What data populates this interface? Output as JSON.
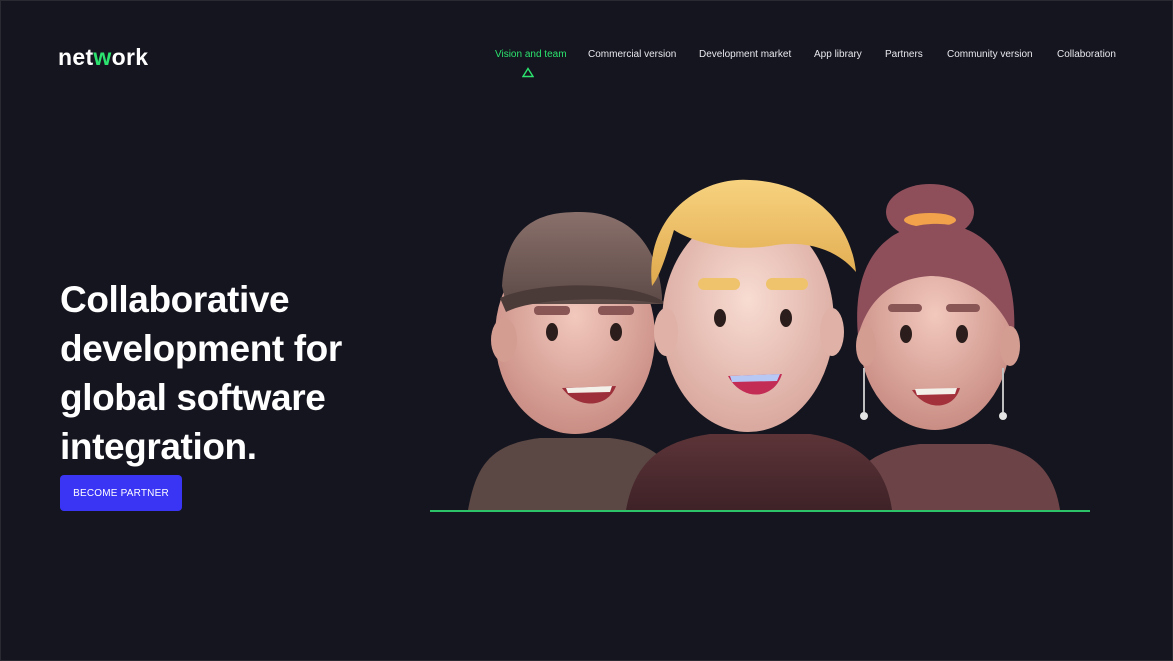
{
  "brand": {
    "logo_part1": "net",
    "logo_accent": "w",
    "logo_part2": "ork"
  },
  "nav": {
    "items": [
      {
        "label": "Vision and team",
        "active": true
      },
      {
        "label": "Commercial version"
      },
      {
        "label": "Development market"
      },
      {
        "label": "App library"
      },
      {
        "label": "Partners"
      },
      {
        "label": "Community version"
      },
      {
        "label": "Collaboration"
      }
    ]
  },
  "hero": {
    "headline": "Collaborative development for global software integration.",
    "cta_label": "BECOME PARTNER"
  },
  "colors": {
    "background": "#15151f",
    "accent_green": "#2be36e",
    "cta_blue": "#3a35f5",
    "text": "#ffffff"
  }
}
